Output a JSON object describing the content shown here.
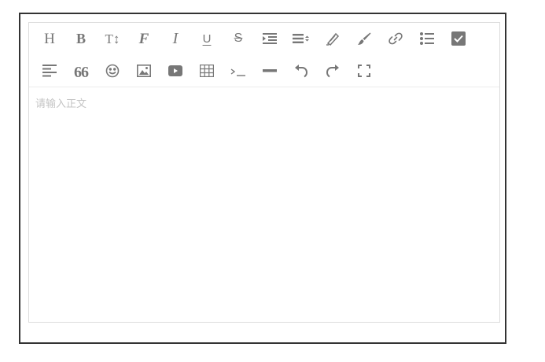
{
  "editor": {
    "placeholder": "请输入正文",
    "toolbar": {
      "row1": [
        {
          "name": "heading-icon",
          "glyph": "H"
        },
        {
          "name": "bold-icon",
          "glyph": "B"
        },
        {
          "name": "text-size-icon",
          "glyph": "T↕"
        },
        {
          "name": "font-family-icon",
          "glyph": "F"
        },
        {
          "name": "italic-icon",
          "glyph": "I"
        },
        {
          "name": "underline-icon",
          "glyph": "U"
        },
        {
          "name": "strikethrough-icon",
          "glyph": "S"
        },
        {
          "name": "indent-icon"
        },
        {
          "name": "line-height-icon"
        },
        {
          "name": "font-color-icon"
        },
        {
          "name": "background-color-icon"
        },
        {
          "name": "link-icon"
        },
        {
          "name": "bulleted-list-icon"
        },
        {
          "name": "checkbox-list-icon"
        }
      ],
      "row2": [
        {
          "name": "justify-icon"
        },
        {
          "name": "quote-icon",
          "glyph": "66"
        },
        {
          "name": "emoji-icon"
        },
        {
          "name": "image-icon"
        },
        {
          "name": "video-icon"
        },
        {
          "name": "table-icon"
        },
        {
          "name": "code-icon"
        },
        {
          "name": "horizontal-rule-icon"
        },
        {
          "name": "undo-icon"
        },
        {
          "name": "redo-icon"
        },
        {
          "name": "fullscreen-icon"
        }
      ]
    },
    "colors": {
      "icon": "#777777",
      "border": "#dcdcdc",
      "frame": "#333333",
      "placeholder": "#c4c4c4"
    }
  }
}
